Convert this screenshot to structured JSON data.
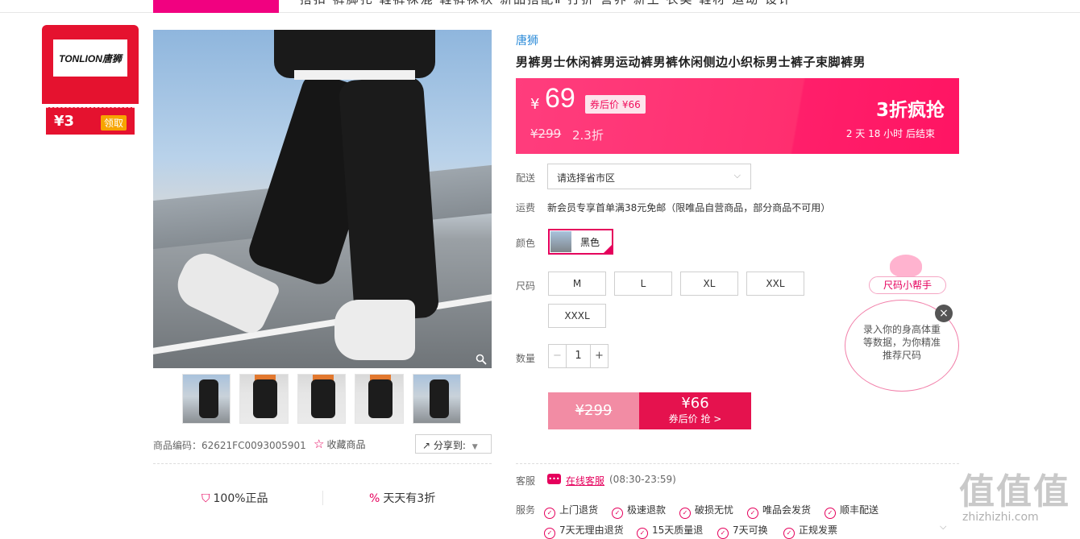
{
  "topnav": {
    "items_text": "搭扣    裤脚扎    鞋裤袜混    鞋裤袜秋    新品搭配Ⅱ    打折    营养    新生    衣类    鞋材    运动    设计"
  },
  "brand_card": {
    "logo": "TONLION唐狮",
    "coupon_price": "¥3",
    "get_label": "领取"
  },
  "gallery": {
    "thumb_count": 5
  },
  "product_meta": {
    "code_label": "商品编码：62621FC0093005901",
    "favorite_label": "收藏商品",
    "share_label": "分享到:"
  },
  "guarantees": {
    "authentic": "100%正品",
    "daily": "天天有3折"
  },
  "product": {
    "brand": "唐狮",
    "title": "男裤男士休闲裤男运动裤男裤休闲侧边小织标男士裤子束脚裤男"
  },
  "price": {
    "currency": "¥",
    "current": "69",
    "coupon_price": "券后价 ¥66",
    "original": "¥299",
    "discount": "2.3折",
    "flash_label": "3折疯抢",
    "ends_in": "2 天 18 小时 后结束"
  },
  "delivery": {
    "label": "配送",
    "placeholder": "请选择省市区"
  },
  "shipping": {
    "label": "运费",
    "text": "新会员专享首单满38元免邮（限唯品自营商品，部分商品不可用）"
  },
  "color": {
    "label": "颜色",
    "selected": "黑色"
  },
  "size": {
    "label": "尺码",
    "options": [
      "M",
      "L",
      "XL",
      "XXL",
      "XXXL"
    ]
  },
  "quantity": {
    "label": "数量",
    "value": "1"
  },
  "buy": {
    "original": "¥299",
    "coupon_price": "¥66",
    "coupon_action": "券后价 抢 >"
  },
  "service_info": {
    "cs_label": "客服",
    "cs_link": "在线客服",
    "cs_hours": "(08:30-23:59)",
    "svc_label": "服务",
    "items": [
      "上门退货",
      "极速退款",
      "破损无忧",
      "唯品会发货",
      "顺丰配送",
      "7天无理由退货",
      "15天质量退",
      "7天可换",
      "正规发票"
    ]
  },
  "size_helper": {
    "tag": "尺码小帮手",
    "text": "录入你的身高体重等数据，为你精准推荐尺码"
  },
  "watermark": {
    "big": "值值值",
    "small": "zhizhizhi.com"
  },
  "colors": {
    "accent": "#e5005c",
    "price_bg": "#ff2e6f",
    "buy_red": "#e5124e"
  }
}
